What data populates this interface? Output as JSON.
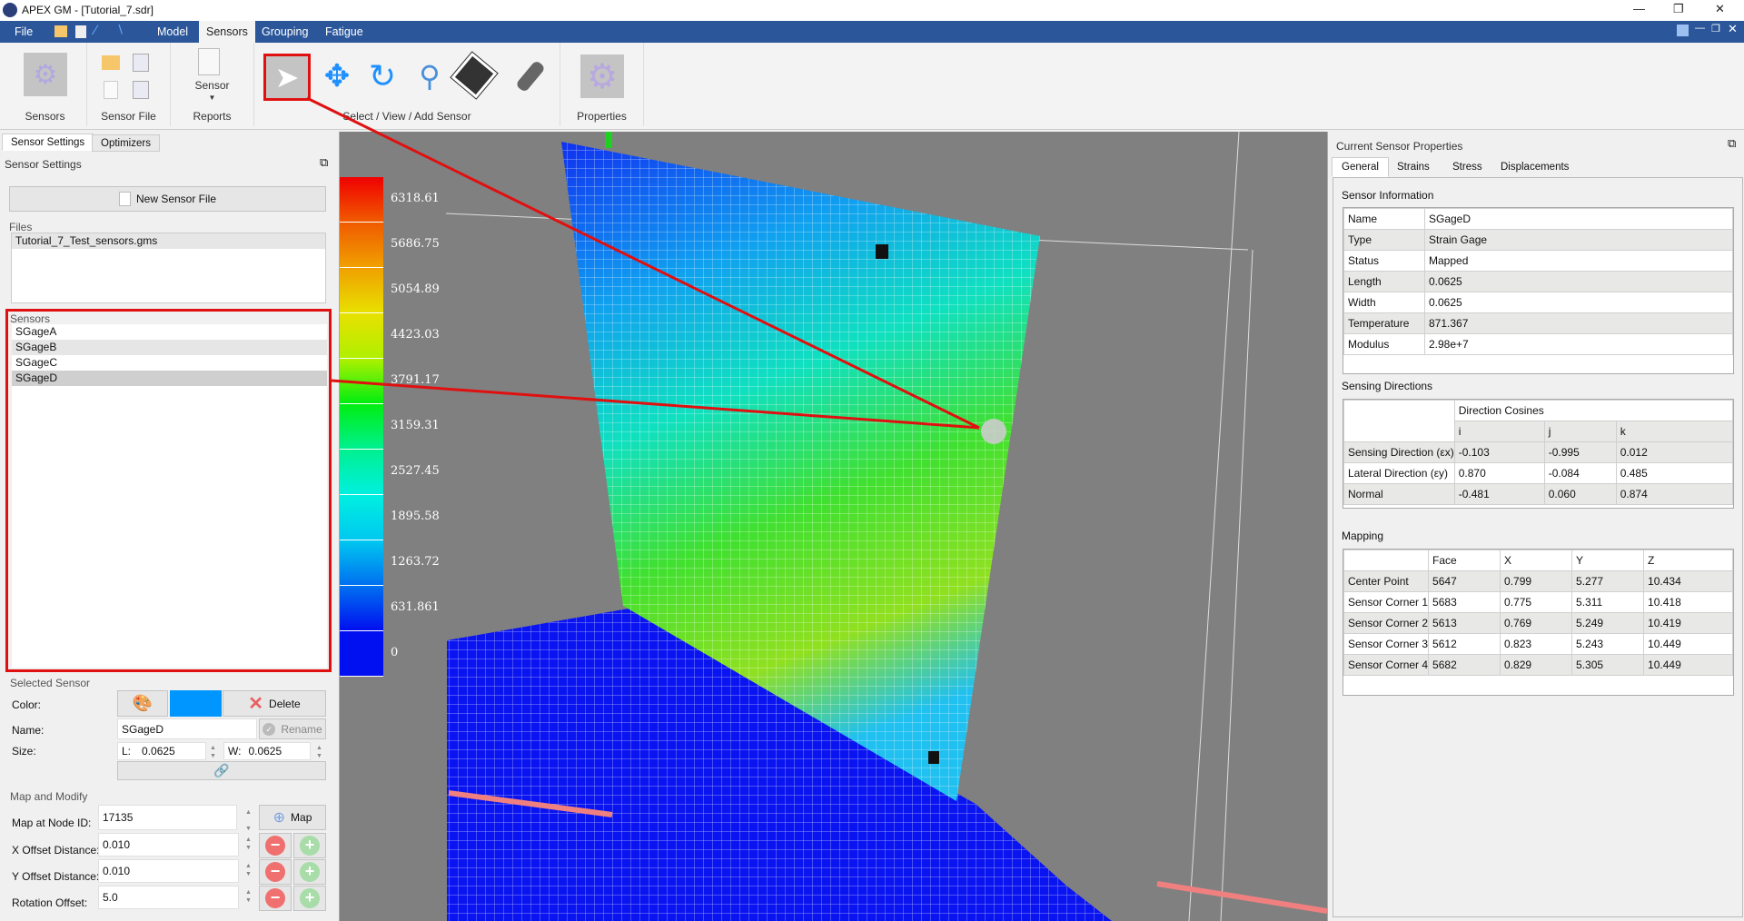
{
  "window": {
    "title": "APEX GM - [Tutorial_7.sdr]"
  },
  "menu": {
    "items": [
      "File",
      "Model",
      "Sensors",
      "Grouping",
      "Fatigue"
    ],
    "active": "Sensors"
  },
  "ribbon": {
    "groups": {
      "sensors": "Sensors",
      "sensor_file": "Sensor File",
      "sensor": "Sensor",
      "reports": "Reports",
      "select_view_add": "Select / View / Add Sensor",
      "properties": "Properties"
    },
    "tools": [
      "select-arrow-icon",
      "pan-icon",
      "rotate-icon",
      "zoom-magnifier-icon",
      "strain-gage-icon",
      "probe-sensor-icon"
    ]
  },
  "left_panel": {
    "tabs": [
      "Sensor Settings",
      "Optimizers"
    ],
    "title": "Sensor Settings",
    "new_sensor_file": "New Sensor File",
    "files_label": "Files",
    "files": [
      "Tutorial_7_Test_sensors.gms"
    ],
    "sensors_label": "Sensors",
    "sensors": [
      "SGageA",
      "SGageB",
      "SGageC",
      "SGageD"
    ],
    "selected_index": 3,
    "selected_sensor": {
      "label": "Selected Sensor",
      "color_label": "Color:",
      "color": "#0096ff",
      "delete": "Delete",
      "name_label": "Name:",
      "name": "SGageD",
      "rename": "Rename",
      "size_label": "Size:",
      "l_label": "L:",
      "l": "0.0625",
      "w_label": "W:",
      "w": "0.0625"
    },
    "map_modify": {
      "label": "Map and Modify",
      "node_label": "Map at Node ID:",
      "node": "17135",
      "map": "Map",
      "x_label": "X Offset Distance:",
      "x": "0.010",
      "y_label": "Y Offset Distance:",
      "y": "0.010",
      "rot_label": "Rotation Offset:",
      "rot": "5.0"
    }
  },
  "legend": {
    "values": [
      "6318.61",
      "5686.75",
      "5054.89",
      "4423.03",
      "3791.17",
      "3159.31",
      "2527.45",
      "1895.58",
      "1263.72",
      "631.861",
      "0"
    ],
    "colors": [
      "#f00000",
      "#f05a00",
      "#f0a000",
      "#e8e000",
      "#b0f000",
      "#00ee10",
      "#00f090",
      "#00f0e0",
      "#00c8f0",
      "#0070f0",
      "#0010f0"
    ]
  },
  "right_panel": {
    "title": "Current Sensor Properties",
    "tabs": [
      "General",
      "Strains",
      "Stress",
      "Displacements"
    ],
    "sensor_info_label": "Sensor Information",
    "sensor_info": [
      [
        "Name",
        "SGageD"
      ],
      [
        "Type",
        "Strain Gage"
      ],
      [
        "Status",
        "Mapped"
      ],
      [
        "Length",
        "0.0625"
      ],
      [
        "Width",
        "0.0625"
      ],
      [
        "Temperature",
        "871.367"
      ],
      [
        "Modulus",
        "2.98e+7"
      ]
    ],
    "sensing_label": "Sensing Directions",
    "direction_cosines": "Direction Cosines",
    "dir_cols": [
      "i",
      "j",
      "k"
    ],
    "directions": [
      [
        "Sensing Direction (εx)",
        "-0.103",
        "-0.995",
        "0.012"
      ],
      [
        "Lateral Direction (εy)",
        "0.870",
        "-0.084",
        "0.485"
      ],
      [
        "Normal",
        "-0.481",
        "0.060",
        "0.874"
      ]
    ],
    "mapping_label": "Mapping",
    "map_cols": [
      "Face",
      "X",
      "Y",
      "Z"
    ],
    "mapping": [
      [
        "Center Point",
        "5647",
        "0.799",
        "5.277",
        "10.434"
      ],
      [
        "Sensor Corner 1",
        "5683",
        "0.775",
        "5.311",
        "10.418"
      ],
      [
        "Sensor Corner 2",
        "5613",
        "0.769",
        "5.249",
        "10.419"
      ],
      [
        "Sensor Corner 3",
        "5612",
        "0.823",
        "5.243",
        "10.449"
      ],
      [
        "Sensor Corner 4",
        "5682",
        "0.829",
        "5.305",
        "10.449"
      ]
    ]
  }
}
